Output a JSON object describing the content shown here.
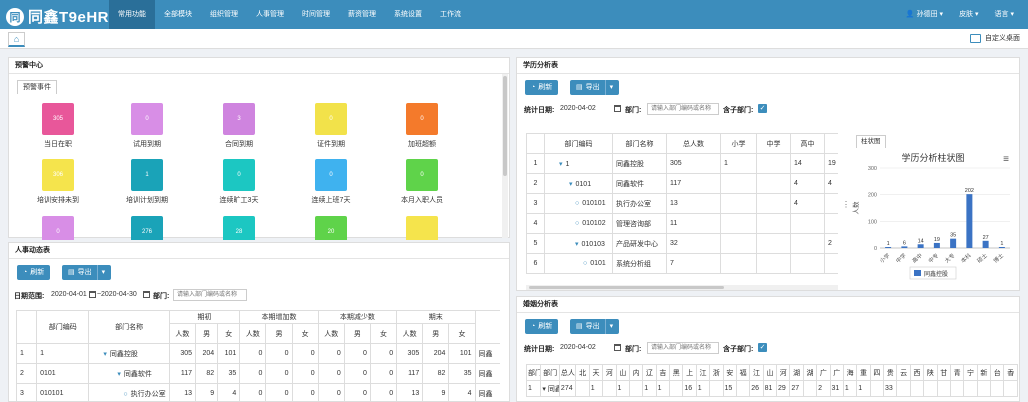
{
  "app": {
    "name": "同鑫T9eHR",
    "logo_mark": "同"
  },
  "nav": {
    "items": [
      "常用功能",
      "全部模块",
      "组织管理",
      "人事管理",
      "时间管理",
      "薪资管理",
      "系统设置",
      "工作流"
    ],
    "active_index": 0
  },
  "user": {
    "name": "孙德田 ▾",
    "skin": "皮肤 ▾",
    "lang": "语言 ▾"
  },
  "tabs": {
    "home_icon": "⌂",
    "custom_desktop": "自定义桌面"
  },
  "warning": {
    "title": "预警中心",
    "tab": "预警事件",
    "tiles": [
      {
        "value": "305",
        "label": "当日在职",
        "color": "#e8579a"
      },
      {
        "value": "0",
        "label": "试用到期",
        "color": "#d88ee6"
      },
      {
        "value": "3",
        "label": "合同到期",
        "color": "#cf84df"
      },
      {
        "value": "0",
        "label": "证件到期",
        "color": "#f2e24a"
      },
      {
        "value": "0",
        "label": "加班超额",
        "color": "#f47a2b"
      },
      {
        "value": "306",
        "label": "培训安排未到",
        "color": "#f5e44c"
      },
      {
        "value": "1",
        "label": "培训计划到期",
        "color": "#1aa3b8"
      },
      {
        "value": "0",
        "label": "连续旷工3天",
        "color": "#1cc7c2"
      },
      {
        "value": "0",
        "label": "连续上班7天",
        "color": "#3fb2ef"
      },
      {
        "value": "0",
        "label": "本月入职人员",
        "color": "#5fd34a"
      },
      {
        "value": "0",
        "label": "",
        "color": "#d88ee6"
      },
      {
        "value": "276",
        "label": "",
        "color": "#1aa3b8"
      },
      {
        "value": "28",
        "label": "",
        "color": "#1cc7c2"
      },
      {
        "value": "20",
        "label": "",
        "color": "#5fd34a"
      },
      {
        "value": "",
        "label": "",
        "color": "#f5e44c"
      }
    ]
  },
  "hr_dynamic": {
    "title": "人事动态表",
    "refresh": "刷新",
    "export": "导出",
    "date_label": "日期范围:",
    "date_from": "2020-04-01",
    "date_sep": "~",
    "date_to": "2020-04-30",
    "dept_label": "部门:",
    "dept_placeholder": "请输入部门编码或名称",
    "head_groups": [
      "期初",
      "本期增加数",
      "本期减少数",
      "期末"
    ],
    "head_sub": [
      "人数",
      "男",
      "女"
    ],
    "col_code": "部门编码",
    "col_name": "部门名称",
    "rows": [
      {
        "idx": "1",
        "code": "1",
        "name": "同鑫控股",
        "toggle": "▾",
        "vals": [
          "305",
          "204",
          "101",
          "0",
          "0",
          "0",
          "0",
          "0",
          "0",
          "305",
          "204",
          "101"
        ],
        "extra": "同鑫"
      },
      {
        "idx": "2",
        "code": "0101",
        "name": "同鑫软件",
        "toggle": "▾",
        "vals": [
          "117",
          "82",
          "35",
          "0",
          "0",
          "0",
          "0",
          "0",
          "0",
          "117",
          "82",
          "35"
        ],
        "extra": "同鑫"
      },
      {
        "idx": "3",
        "code": "010101",
        "name": "执行办公室",
        "toggle": "○",
        "vals": [
          "13",
          "9",
          "4",
          "0",
          "0",
          "0",
          "0",
          "0",
          "0",
          "13",
          "9",
          "4"
        ],
        "extra": "同鑫"
      }
    ]
  },
  "edu": {
    "title": "学历分析表",
    "refresh": "刷新",
    "export": "导出",
    "date_label": "统计日期:",
    "date": "2020-04-02",
    "dept_label": "部门:",
    "dept_placeholder": "请输入部门编码或名称",
    "sub_label": "含子部门:",
    "check": "✓",
    "cols": [
      "部门编码",
      "部门名称",
      "总人数",
      "小学",
      "中学",
      "高中"
    ],
    "rows": [
      {
        "idx": "1",
        "code": "1",
        "name": "同鑫控股",
        "toggle": "▾",
        "total": "305",
        "c1": "1",
        "c2": "",
        "c3": "14",
        "c4": "19"
      },
      {
        "idx": "2",
        "code": "0101",
        "name": "同鑫软件",
        "toggle": "▾",
        "total": "117",
        "c1": "",
        "c2": "",
        "c3": "4",
        "c4": "4"
      },
      {
        "idx": "3",
        "code": "010101",
        "name": "执行办公室",
        "toggle": "○",
        "total": "13",
        "c1": "",
        "c2": "",
        "c3": "4",
        "c4": ""
      },
      {
        "idx": "4",
        "code": "010102",
        "name": "管理咨询部",
        "toggle": "○",
        "total": "11",
        "c1": "",
        "c2": "",
        "c3": "",
        "c4": ""
      },
      {
        "idx": "5",
        "code": "010103",
        "name": "产品研发中心",
        "toggle": "▾",
        "total": "32",
        "c1": "",
        "c2": "",
        "c3": "",
        "c4": "2"
      },
      {
        "idx": "6",
        "code": "0101",
        "name": "系统分析组",
        "toggle": "○",
        "total": "7",
        "c1": "",
        "c2": "",
        "c3": "",
        "c4": ""
      }
    ],
    "chart_tab": "柱状图"
  },
  "chart_data": {
    "type": "bar",
    "title": "学历分析柱状图",
    "ylabel": "人数",
    "ylim": [
      0,
      300
    ],
    "yticks": [
      0,
      100,
      200,
      300
    ],
    "categories": [
      "小学",
      "中学",
      "高中",
      "中专",
      "大专",
      "本科",
      "硕士",
      "博士"
    ],
    "series": [
      {
        "name": "同鑫控股",
        "values": [
          1,
          6,
          14,
          19,
          35,
          202,
          27,
          1
        ]
      }
    ],
    "color": "#3b73c4",
    "legend": "bottom"
  },
  "marriage": {
    "title": "婚姻分析表",
    "refresh": "刷新",
    "export": "导出",
    "date_label": "统计日期:",
    "date": "2020-04-02",
    "dept_label": "部门:",
    "dept_placeholder": "请输入部门编码或名称",
    "sub_label": "含子部门:",
    "check": "✓",
    "head": [
      "部门",
      "部门",
      "总人",
      "北",
      "天",
      "河",
      "山",
      "内",
      "辽",
      "吉",
      "黑",
      "上",
      "江",
      "浙",
      "安",
      "福",
      "江",
      "山",
      "河",
      "湖",
      "湖",
      "广",
      "广",
      "海",
      "重",
      "四",
      "贵",
      "云",
      "西",
      "陕",
      "甘",
      "青",
      "宁",
      "新",
      "台",
      "香"
    ],
    "row": [
      "1",
      "▾ 同鑫",
      "274",
      "",
      "1",
      "",
      "1",
      "",
      "1",
      "1",
      "",
      "16",
      "1",
      "",
      "15",
      "",
      "26",
      "81",
      "29",
      "27",
      "",
      "2",
      "31",
      "1",
      "1",
      "",
      "33",
      "",
      "",
      "",
      "",
      "",
      "",
      "",
      "",
      ""
    ]
  }
}
